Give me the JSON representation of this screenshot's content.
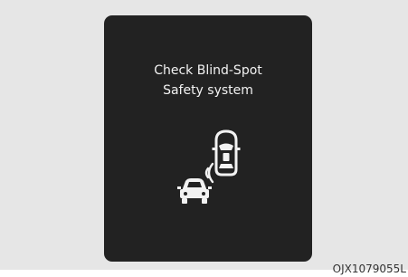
{
  "display": {
    "message_line1": "Check Blind-Spot",
    "message_line2": "Safety system",
    "icon": "blind-spot-cars-icon"
  },
  "figure_code": "OJX1079055L",
  "colors": {
    "background": "#e6e6e6",
    "display": "#222222",
    "text": "#f2f2f2"
  }
}
